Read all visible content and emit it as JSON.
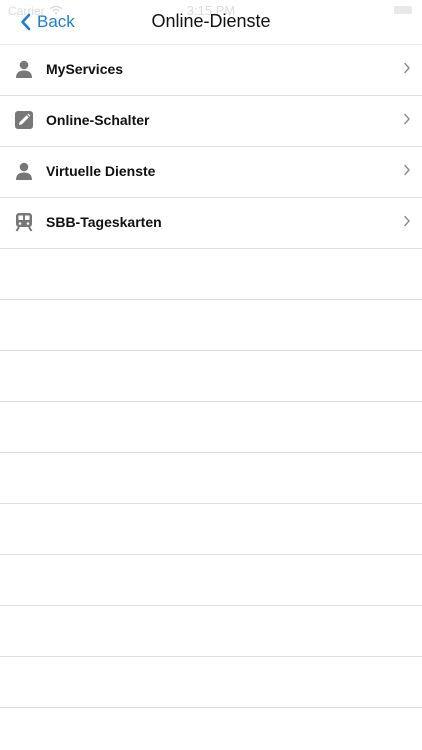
{
  "status_bar": {
    "carrier": "Carrier",
    "time": "3:15 PM"
  },
  "nav": {
    "back_label": "Back",
    "title": "Online-Dienste"
  },
  "items": [
    {
      "label": "MyServices",
      "icon": "person-icon"
    },
    {
      "label": "Online-Schalter",
      "icon": "pencil-square-icon"
    },
    {
      "label": "Virtuelle Dienste",
      "icon": "person-icon"
    },
    {
      "label": "SBB-Tageskarten",
      "icon": "train-icon"
    }
  ],
  "colors": {
    "accent": "#1a7ed6",
    "icon_gray": "#777777",
    "separator": "#dedede"
  }
}
